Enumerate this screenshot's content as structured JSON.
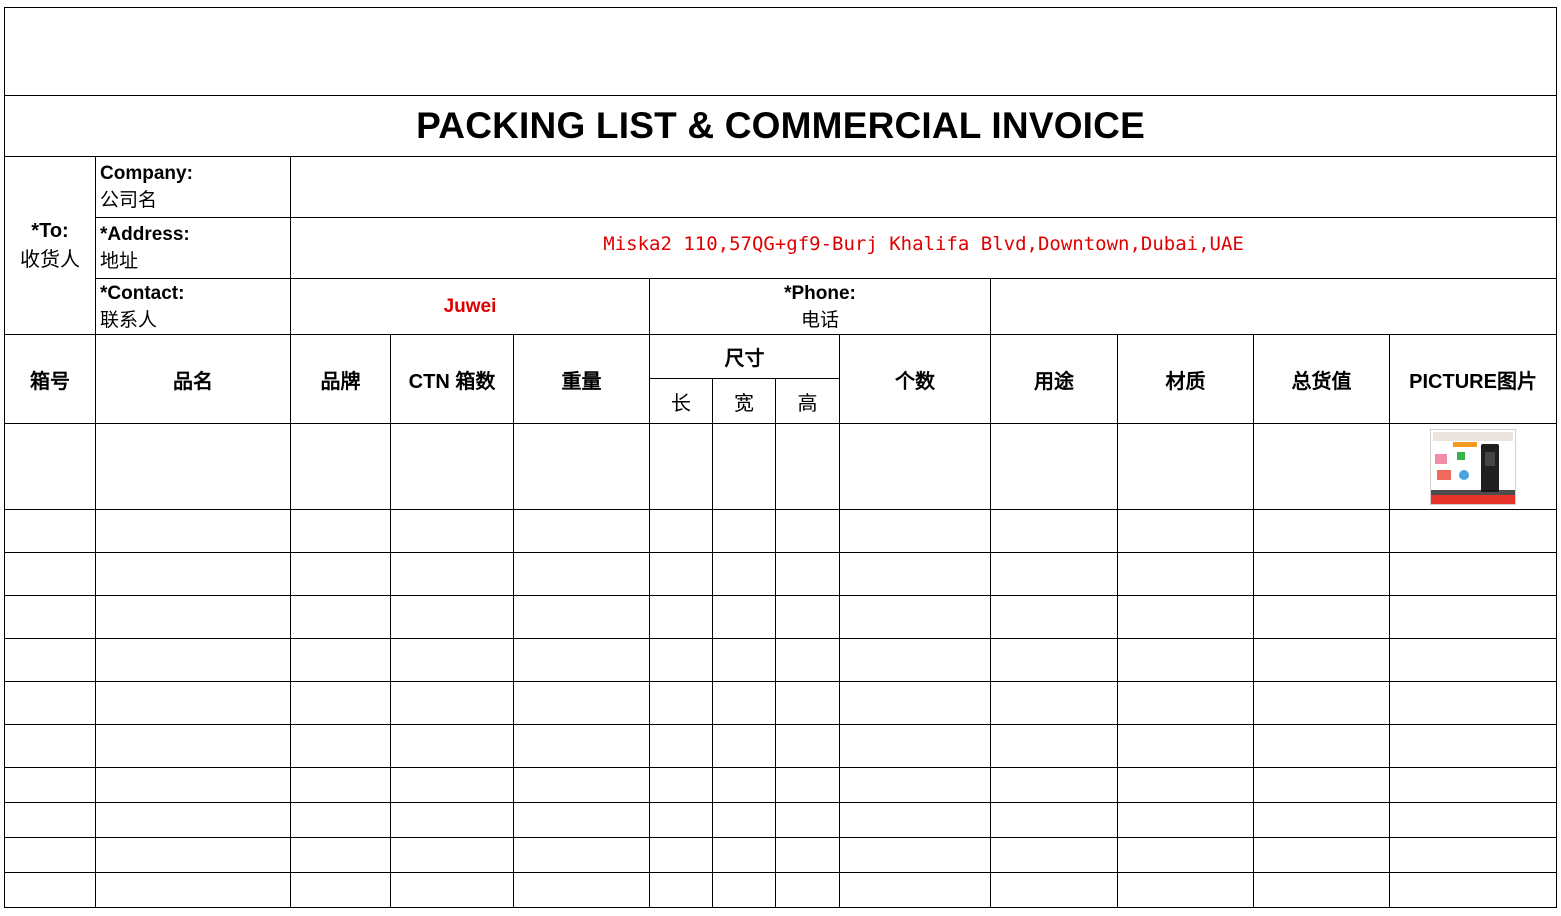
{
  "title": "PACKING LIST & COMMERCIAL INVOICE",
  "to": {
    "label_en": "*To:",
    "label_cn": "收货人"
  },
  "company": {
    "label_en": "Company:",
    "label_cn": "公司名",
    "value": ""
  },
  "address": {
    "label_en": "*Address:",
    "label_cn": "地址",
    "value": "Miska2 110,57QG+gf9-Burj Khalifa Blvd,Downtown,Dubai,UAE"
  },
  "contact": {
    "label_en": "*Contact:",
    "label_cn": "联系人",
    "value": "Juwei"
  },
  "phone": {
    "label_en": "*Phone:",
    "label_cn": "电话",
    "value": ""
  },
  "columns": {
    "box_no": "箱号",
    "product_name": "品名",
    "brand": "品牌",
    "ctn_count": "CTN 箱数",
    "weight": "重量",
    "size": "尺寸",
    "length": "长",
    "width": "宽",
    "height": "高",
    "quantity": "个数",
    "usage": "用途",
    "material": "材质",
    "total_value": "总货值",
    "picture": "PICTURE图片"
  },
  "colors": {
    "highlight_text": "#e00000",
    "grid_line": "#000000"
  }
}
